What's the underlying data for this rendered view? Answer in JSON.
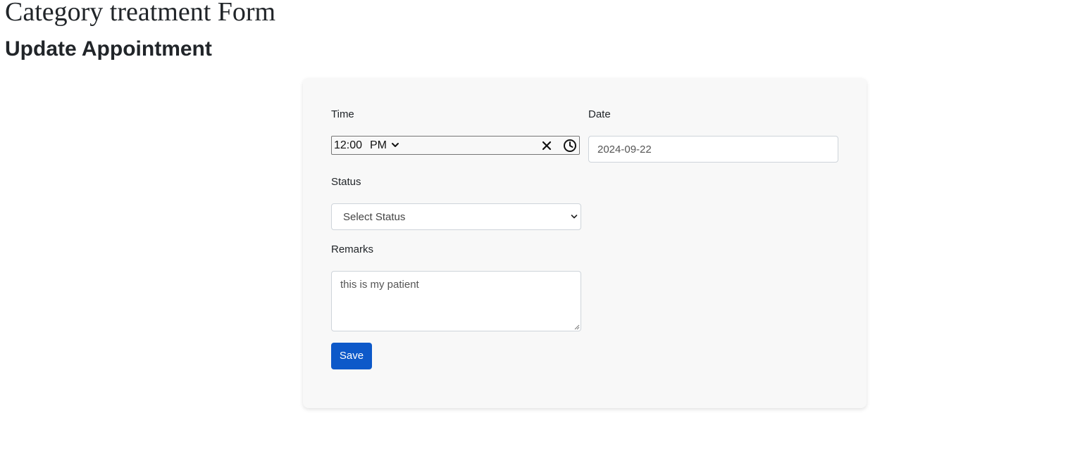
{
  "page": {
    "title": "Category treatment Form",
    "subtitle": "Update Appointment"
  },
  "form": {
    "time_label": "Time",
    "time_value": "12:00",
    "time_period": "PM",
    "date_label": "Date",
    "date_value": "2024-09-22",
    "status_label": "Status",
    "status_selected": "Select Status",
    "remarks_label": "Remarks",
    "remarks_value": "this is my patient",
    "save_label": "Save"
  },
  "icons": {
    "time_period_dropdown": "chevron-down-icon",
    "time_clear": "close-icon",
    "time_picker": "clock-icon",
    "status_dropdown": "chevron-down-icon",
    "remarks_resize": "resize-grip-icon"
  },
  "colors": {
    "primary_button": "#0d59c9",
    "card_background": "#f8f8f8"
  }
}
